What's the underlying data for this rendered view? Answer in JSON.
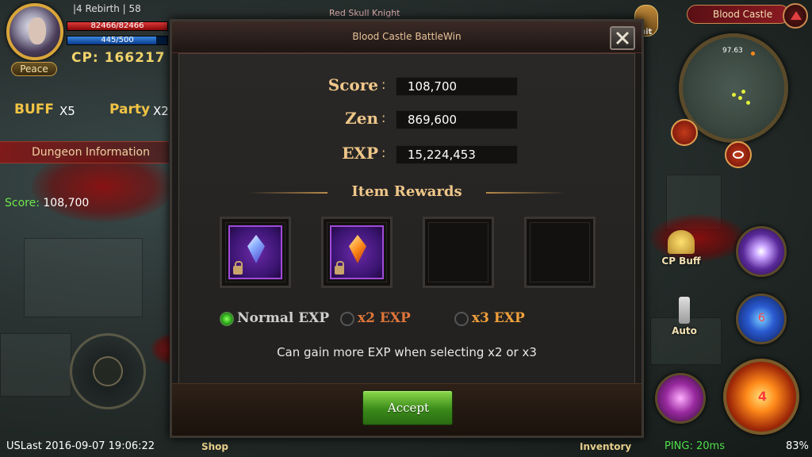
{
  "player": {
    "level": "|4 Rebirth | 58",
    "hp": "82466/82466",
    "hp_fraction": 1.0,
    "mp": "445/500",
    "mp_fraction": 0.89,
    "cp": "CP: 166217",
    "stance": "Peace"
  },
  "buffs": {
    "buff_label": "BUFF",
    "buff_count": "X5",
    "party_label": "Party",
    "party_count": "X2"
  },
  "dungeon": {
    "title": "Dungeon Information",
    "score_label": "Score:",
    "score_value": "108,700"
  },
  "target": {
    "name": "Red Skull Knight"
  },
  "minimap": {
    "location": "Blood Castle",
    "coords": "97.63"
  },
  "side_buttons": {
    "cp_buff": "CP Buff",
    "auto": "Auto",
    "quit": "uit"
  },
  "skills": {
    "skill_2_cooldown": "6",
    "main_skill_cooldown": "4"
  },
  "modal": {
    "title": "Blood Castle BattleWin",
    "stats": [
      {
        "label": "Score",
        "value": "108,700"
      },
      {
        "label": "Zen",
        "value": "869,600"
      },
      {
        "label": "EXP",
        "value": "15,224,453"
      }
    ],
    "colon": ":",
    "rewards_title": "Item Rewards",
    "reward_slots": [
      {
        "item": "purple-crystal",
        "locked": true
      },
      {
        "item": "orange-gem",
        "locked": true
      },
      {
        "item": "",
        "locked": false
      },
      {
        "item": "",
        "locked": false
      }
    ],
    "exp_options": [
      {
        "label": "Normal EXP",
        "selected": true
      },
      {
        "label": "x2 EXP",
        "selected": false
      },
      {
        "label": "x3 EXP",
        "selected": false
      }
    ],
    "hint": "Can gain more EXP when selecting x2 or x3",
    "accept_label": "Accept"
  },
  "footer": {
    "date": "USLast 2016-09-07 19:06:22",
    "shop": "Shop",
    "inventory": "Inventory",
    "ping": "PING: 20ms",
    "battery": "83%"
  }
}
